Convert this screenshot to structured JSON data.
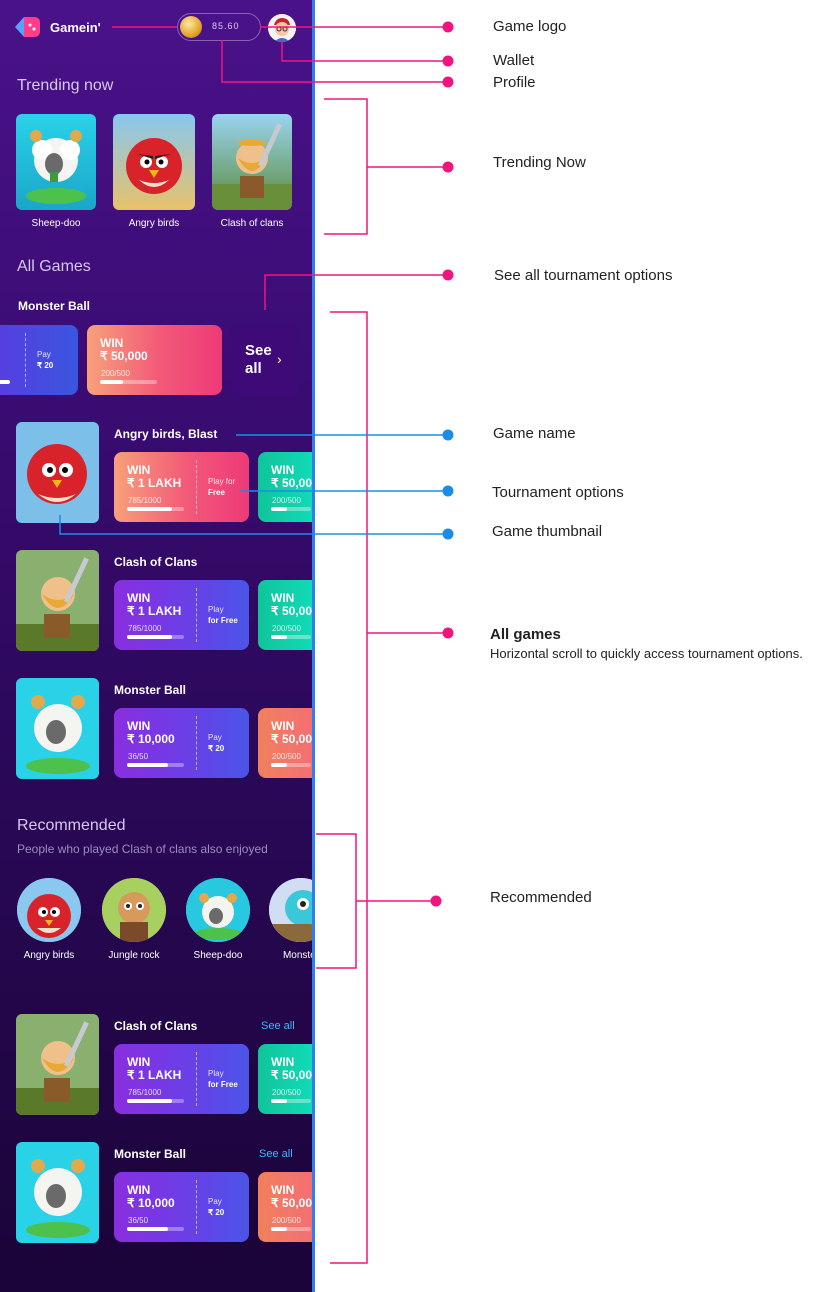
{
  "app": {
    "name": "Gamein'"
  },
  "wallet": {
    "balance": "85.60"
  },
  "trending": {
    "title": "Trending now",
    "items": [
      {
        "label": "Sheep-doo"
      },
      {
        "label": "Angry birds"
      },
      {
        "label": "Clash of clans"
      }
    ]
  },
  "all_games": {
    "title": "All Games",
    "first": {
      "name": "Monster Ball",
      "partial_card": {
        "play_label": "Pay",
        "play_value": "₹ 20"
      },
      "card": {
        "win": "WIN",
        "amount": "₹ 50,000",
        "count": "200/500",
        "progress": 0.4
      },
      "see_all": "See all",
      "chevron": "›"
    },
    "games": [
      {
        "name": "Angry birds, Blast",
        "card1": {
          "win": "WIN",
          "amount": "₹ 1 LAKH",
          "count": "785/1000",
          "progress": 0.785,
          "play1": "Play for",
          "play2": "Free"
        },
        "card2": {
          "win": "WIN",
          "amount": "₹ 50,00",
          "count": "200/500",
          "progress": 0.4
        }
      },
      {
        "name": "Clash of Clans",
        "card1": {
          "win": "WIN",
          "amount": "₹ 1 LAKH",
          "count": "785/1000",
          "progress": 0.785,
          "play1": "Play",
          "play2": "for Free"
        },
        "card2": {
          "win": "WIN",
          "amount": "₹ 50,00",
          "count": "200/500",
          "progress": 0.4
        }
      },
      {
        "name": "Monster Ball",
        "card1": {
          "win": "WIN",
          "amount": "₹ 10,000",
          "count": "36/50",
          "progress": 0.72,
          "play1": "Pay",
          "play2": "₹ 20"
        },
        "card2": {
          "win": "WIN",
          "amount": "₹ 50,00",
          "count": "200/500",
          "progress": 0.4
        }
      }
    ]
  },
  "recommended": {
    "title": "Recommended",
    "subtitle": "People who played Clash of clans also enjoyed",
    "items": [
      {
        "label": "Angry birds"
      },
      {
        "label": "Jungle rock"
      },
      {
        "label": "Sheep-doo"
      },
      {
        "label": "Monster"
      }
    ],
    "games": [
      {
        "name": "Clash of Clans",
        "see_all": "See all",
        "card1": {
          "win": "WIN",
          "amount": "₹ 1 LAKH",
          "count": "785/1000",
          "progress": 0.785,
          "play1": "Play",
          "play2": "for Free"
        },
        "card2": {
          "win": "WIN",
          "amount": "₹ 50,00",
          "count": "200/500",
          "progress": 0.4
        }
      },
      {
        "name": "Monster Ball",
        "see_all": "See all",
        "card1": {
          "win": "WIN",
          "amount": "₹ 10,000",
          "count": "36/50",
          "progress": 0.72,
          "play1": "Pay",
          "play2": "₹ 20"
        },
        "card2": {
          "win": "WIN",
          "amount": "₹ 50,00",
          "count": "200/500",
          "progress": 0.4
        }
      }
    ]
  },
  "annotations": {
    "game_logo": "Game logo",
    "wallet": "Wallet",
    "profile": "Profile",
    "trending_now": "Trending Now",
    "see_all_tournament": "See all tournament options",
    "game_name": "Game name",
    "tournament_options": "Tournament options",
    "game_thumbnail": "Game thumbnail",
    "all_games": "All games",
    "all_games_desc": "Horizontal scroll to quickly access tournament options.",
    "recommended": "Recommended"
  },
  "colors": {
    "annotation_pink": "#f0157e",
    "annotation_blue": "#1a8de6",
    "phone_edge": "#2f7ef0"
  }
}
